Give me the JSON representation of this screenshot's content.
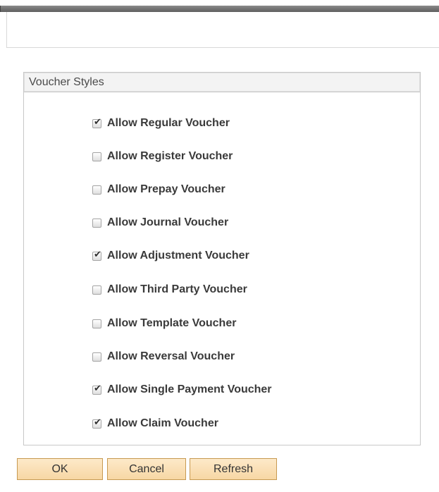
{
  "group": {
    "title": "Voucher Styles"
  },
  "options": [
    {
      "label": "Allow Regular Voucher",
      "checked": true
    },
    {
      "label": "Allow Register Voucher",
      "checked": false
    },
    {
      "label": "Allow Prepay Voucher",
      "checked": false
    },
    {
      "label": "Allow Journal Voucher",
      "checked": false
    },
    {
      "label": "Allow Adjustment Voucher",
      "checked": true
    },
    {
      "label": "Allow Third Party Voucher",
      "checked": false
    },
    {
      "label": "Allow Template Voucher",
      "checked": false
    },
    {
      "label": "Allow Reversal Voucher",
      "checked": false
    },
    {
      "label": "Allow Single Payment Voucher",
      "checked": true
    },
    {
      "label": "Allow Claim Voucher",
      "checked": true
    }
  ],
  "buttons": {
    "ok": "OK",
    "cancel": "Cancel",
    "refresh": "Refresh"
  },
  "colors": {
    "button_border": "#c79a52",
    "button_fill": "#f7d7a4",
    "group_header_bg": "#f3f3f3"
  }
}
